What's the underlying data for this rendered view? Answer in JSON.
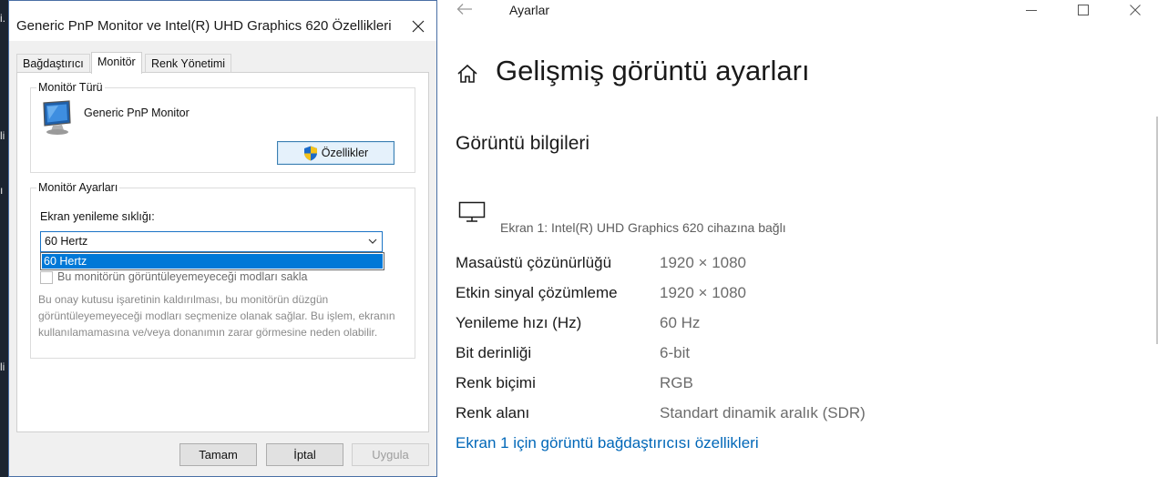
{
  "dialog": {
    "title": "Generic PnP Monitor ve Intel(R) UHD Graphics 620 Özellikleri",
    "tabs": [
      {
        "label": "Bağdaştırıcı"
      },
      {
        "label": "Monitör"
      },
      {
        "label": "Renk Yönetimi"
      }
    ],
    "active_tab": "Monitör",
    "monitor_type": {
      "legend": "Monitör Türü",
      "name": "Generic PnP Monitor",
      "properties_button": "Özellikler"
    },
    "monitor_settings": {
      "legend": "Monitör Ayarları",
      "refresh_label": "Ekran yenileme sıklığı:",
      "selected_value": "60 Hertz",
      "dropdown_options": [
        "60 Hertz"
      ],
      "hide_modes_label": "Bu monitörün görüntüleyemeyeceği modları sakla",
      "hide_modes_checked": false,
      "note": "Bu onay kutusu işaretinin kaldırılması, bu monitörün düzgün görüntüleyemeyeceği modları seçmenize olanak sağlar. Bu işlem, ekranın kullanılamamasına ve/veya donanımın zarar görmesine neden olabilir."
    },
    "buttons": {
      "ok": "Tamam",
      "cancel": "İptal",
      "apply": "Uygula"
    }
  },
  "settings": {
    "app_title": "Ayarlar",
    "page_title": "Gelişmiş görüntü ayarları",
    "section_title": "Görüntü bilgileri",
    "display_description": "Ekran 1: Intel(R) UHD Graphics 620 cihazına bağlı",
    "info": [
      {
        "key": "Masaüstü çözünürlüğü",
        "value": "1920 × 1080"
      },
      {
        "key": "Etkin sinyal çözümleme",
        "value": "1920 × 1080"
      },
      {
        "key": "Yenileme hızı (Hz)",
        "value": "60 Hz"
      },
      {
        "key": "Bit derinliği",
        "value": "6-bit"
      },
      {
        "key": "Renk biçimi",
        "value": "RGB"
      },
      {
        "key": "Renk alanı",
        "value": "Standart dinamik aralık (SDR)"
      }
    ],
    "adapter_link": "Ekran 1 için görüntü bağdaştırıcısı özellikleri"
  },
  "desktop": {
    "glyphs": [
      "i.",
      "li",
      "ı",
      "li"
    ]
  },
  "colors": {
    "accent": "#0078d7",
    "link": "#0067b8",
    "dialog_bg": "#f0f0f0"
  }
}
